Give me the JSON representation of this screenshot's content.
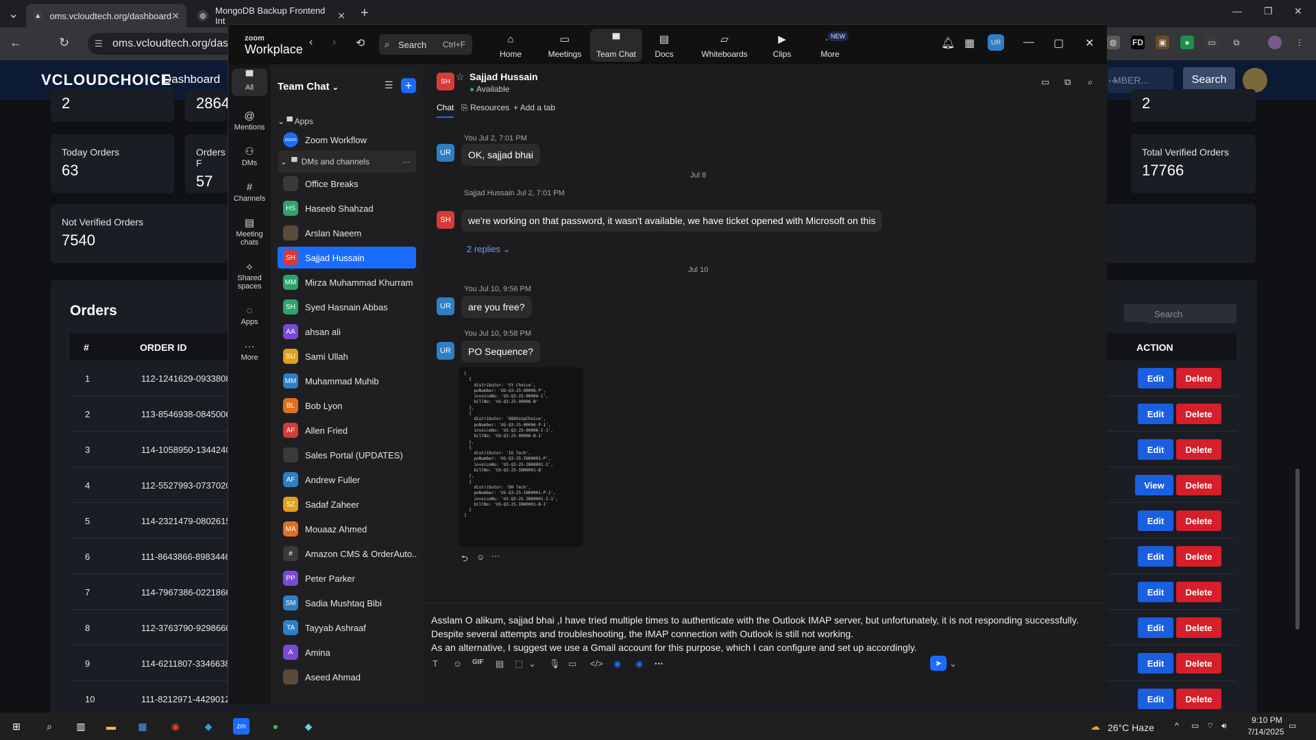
{
  "browser": {
    "tabs": [
      {
        "title": "oms.vcloudtech.org/dashboard"
      },
      {
        "title": "MongoDB Backup Frontend Int"
      }
    ],
    "url": "oms.vcloudtech.org/dashbo"
  },
  "app": {
    "logo": "CLOUDCHOICE",
    "nav_link": "Dashboard",
    "search_placeholder": "MBER...",
    "search_button": "Search",
    "cards": {
      "top_left_value": "2",
      "top_second_value": "2864",
      "top_right_value": "2",
      "today_orders": {
        "label": "Today Orders",
        "value": "63"
      },
      "orders_second": {
        "label": "Orders F",
        "value": "57"
      },
      "not_verified": {
        "label": "Not Verified Orders",
        "value": "7540"
      },
      "total_verified": {
        "label": "Total Verified Orders",
        "value": "17766"
      }
    },
    "orders": {
      "title": "Orders",
      "filter_search_placeholder": "Search",
      "headers": {
        "num": "#",
        "order_id": "ORDER ID",
        "action": "ACTION"
      },
      "rows": [
        {
          "num": "1",
          "order_id": "112-1241629-0933808",
          "primary": "Edit"
        },
        {
          "num": "2",
          "order_id": "113-8546938-0845006",
          "primary": "Edit"
        },
        {
          "num": "3",
          "order_id": "114-1058950-1344240",
          "primary": "Edit"
        },
        {
          "num": "4",
          "order_id": "112-5527993-0737020",
          "primary": "View"
        },
        {
          "num": "5",
          "order_id": "114-2321479-0802615",
          "primary": "Edit"
        },
        {
          "num": "6",
          "order_id": "111-8643866-8983446",
          "primary": "Edit"
        },
        {
          "num": "7",
          "order_id": "114-7967386-0221866",
          "primary": "Edit"
        },
        {
          "num": "8",
          "order_id": "112-3763790-9298660",
          "primary": "Edit"
        },
        {
          "num": "9",
          "order_id": "114-6211807-3346638",
          "primary": "Edit"
        },
        {
          "num": "10",
          "order_id": "111-8212971-4429012",
          "primary": "Edit"
        }
      ],
      "delete_label": "Delete"
    }
  },
  "zoom": {
    "brand_top": "zoom",
    "brand_bottom": "Workplace",
    "search_label": "Search",
    "search_shortcut": "Ctrl+F",
    "nav": [
      {
        "label": "Home",
        "icon": "home-icon"
      },
      {
        "label": "Meetings",
        "icon": "video-icon"
      },
      {
        "label": "Team Chat",
        "icon": "chat-icon"
      },
      {
        "label": "Docs",
        "icon": "doc-icon"
      },
      {
        "label": "Whiteboards",
        "icon": "whiteboard-icon"
      },
      {
        "label": "Clips",
        "icon": "clips-icon"
      },
      {
        "label": "More",
        "icon": "more-icon"
      }
    ],
    "new_badge": "NEW",
    "profile_initials": "UR",
    "rail": [
      {
        "label": "All"
      },
      {
        "label": "Mentions"
      },
      {
        "label": "DMs"
      },
      {
        "label": "Channels"
      },
      {
        "label": "Meeting chats"
      },
      {
        "label": "Shared spaces"
      },
      {
        "label": "Apps"
      },
      {
        "label": "More"
      }
    ],
    "list": {
      "title": "Team Chat",
      "apps_section": "Apps",
      "zoom_workflow": "Zoom Workflow",
      "dms_section": "DMs and channels",
      "items": [
        {
          "initials": "",
          "name": "Office Breaks",
          "color": "#3a3a3d"
        },
        {
          "initials": "HS",
          "name": "Haseeb Shahzad",
          "color": "#2ea36b"
        },
        {
          "initials": "",
          "name": "Arslan Naeem",
          "color": "#5b4a3a"
        },
        {
          "initials": "SH",
          "name": "Sajjad Hussain",
          "color": "#d63a3a"
        },
        {
          "initials": "MM",
          "name": "Mirza Muhammad Khurram",
          "color": "#2ea36b"
        },
        {
          "initials": "SH",
          "name": "Syed Hasnain Abbas",
          "color": "#2ea36b"
        },
        {
          "initials": "AA",
          "name": "ahsan ali",
          "color": "#7a4ad6"
        },
        {
          "initials": "SU",
          "name": "Sami Ullah",
          "color": "#e0a020"
        },
        {
          "initials": "MM",
          "name": "Muhammad Muhib",
          "color": "#2e7fc4"
        },
        {
          "initials": "BL",
          "name": "Bob Lyon",
          "color": "#e07020"
        },
        {
          "initials": "AF",
          "name": "Allen Fried",
          "color": "#d63a3a"
        },
        {
          "initials": "",
          "name": "Sales Portal (UPDATES)",
          "color": "#3a3a3d"
        },
        {
          "initials": "AF",
          "name": "Andrew Fuller",
          "color": "#2e7fc4"
        },
        {
          "initials": "SZ",
          "name": "Sadaf Zaheer",
          "color": "#e0a020"
        },
        {
          "initials": "MA",
          "name": "Mouaaz Ahmed",
          "color": "#e07020"
        },
        {
          "initials": "#",
          "name": "Amazon CMS & OrderAuto...",
          "color": "#3a3a3d"
        },
        {
          "initials": "PP",
          "name": "Peter Parker",
          "color": "#7a4ad6"
        },
        {
          "initials": "SM",
          "name": "Sadia Mushtaq Bibi",
          "color": "#2e7fc4"
        },
        {
          "initials": "TA",
          "name": "Tayyab Ashraaf",
          "color": "#2e7fc4"
        },
        {
          "initials": "A",
          "name": "Amina",
          "color": "#7a4ad6"
        },
        {
          "initials": "",
          "name": "Aseed Ahmad",
          "color": "#5b4a3a"
        }
      ]
    },
    "chat": {
      "contact_initials": "SH",
      "contact_name": "Sajjad Hussain",
      "contact_status": "Available",
      "tabs": [
        "Chat",
        "Resources",
        "Add a tab"
      ],
      "messages": {
        "m1_meta": "You Jul 2, 7:01 PM",
        "m1_text": "OK, sajjad bhai",
        "sep1": "Jul 8",
        "m2_meta": "Sajjad Hussain Jul 2, 7:01 PM",
        "m2_text": "we're working on that password, it wasn't available, we have ticket opened with Microsoft on this",
        "m2_replies": "2 replies",
        "sep2": "Jul 10",
        "m3_meta": "You Jul 10, 9:56 PM",
        "m3_text": "are you free?",
        "m4_meta": "You Jul 10, 9:58 PM",
        "m4_text": "PO Sequence?",
        "code": "[\n  {\n    distributor: 'SY Choice',\n    poNumber: 'US-Q3-25-00006-P',\n    invoiceNo: 'US-Q3-25-00006-I',\n    billNo: 'US-Q3-25-00006-B'\n  },\n  {\n    distributor: '888VoipChoice',\n    poNumber: 'US-Q3-25-00006-P-1',\n    invoiceNo: 'US-Q3-25-00006-I-1',\n    billNo: 'US-Q3-25-00006-B-1'\n  },\n  {\n    distributor: 'IG Tech',\n    poNumber: 'US-Q3-25-IN00001-P',\n    invoiceNo: 'US-Q3-25-IN00001-I',\n    billNo: 'US-Q3-25-IN00001-B'\n  },\n  {\n    distributor: 'DH Tech',\n    poNumber: 'US-Q3-25-IN00001-P-1',\n    invoiceNo: 'US-Q3-25-IN00001-I-1',\n    billNo: 'US-Q3-25-IN00001-B-1'\n  }\n]"
      },
      "compose": "Asslam O alikum, sajjad bhai ,I have tried multiple times to authenticate with the Outlook IMAP server, but unfortunately, it is not responding successfully. Despite several attempts and troubleshooting, the IMAP connection with Outlook is still not working.\nAs an alternative, I suggest we use a Gmail account for this purpose, which I can configure and set up accordingly.",
      "gif_label": "GIF"
    }
  },
  "taskbar": {
    "weather": "26°C  Haze",
    "time": "9:10 PM",
    "date": "7/14/2025"
  }
}
